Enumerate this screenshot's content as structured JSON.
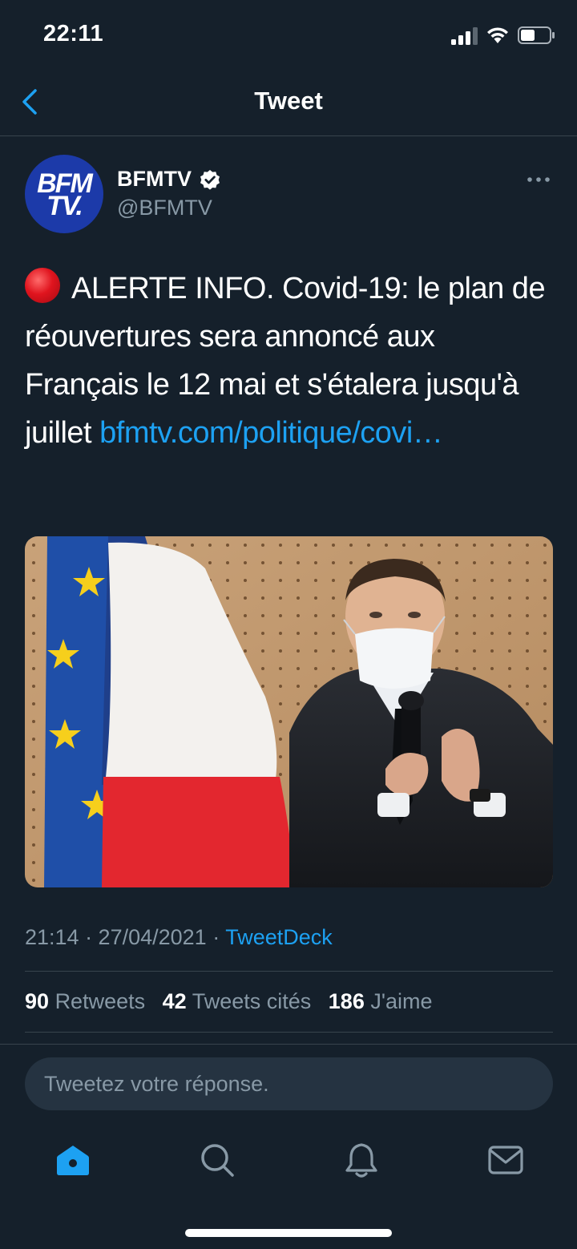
{
  "status_bar": {
    "time": "22:11"
  },
  "header": {
    "title": "Tweet",
    "back_icon": "chevron-left-icon"
  },
  "tweet": {
    "author": {
      "display_name": "BFMTV",
      "username": "@BFMTV",
      "verified": true,
      "avatar_logo_line1": "BFM",
      "avatar_logo_line2": "TV."
    },
    "text": "ALERTE INFO. Covid-19: le plan de réouvertures sera annoncé aux Français le 12 mai et s'étalera jusqu'à juillet",
    "link": "bfmtv.com/politique/covi…",
    "timestamp": "21:14 · 27/04/2021",
    "meta_separator": " · ",
    "source": "TweetDeck",
    "stats": {
      "retweets_count": "90",
      "retweets_label": "Retweets",
      "quotes_count": "42",
      "quotes_label": "Tweets cités",
      "likes_count": "186",
      "likes_label": "J'aime"
    }
  },
  "reply": {
    "placeholder": "Tweetez votre réponse."
  },
  "tab_bar": {
    "items": [
      "home-icon",
      "search-icon",
      "notifications-icon",
      "messages-icon"
    ]
  },
  "colors": {
    "background": "#15202b",
    "accent": "#1da1f2",
    "secondary_text": "#8899a6",
    "border": "#38444d"
  }
}
